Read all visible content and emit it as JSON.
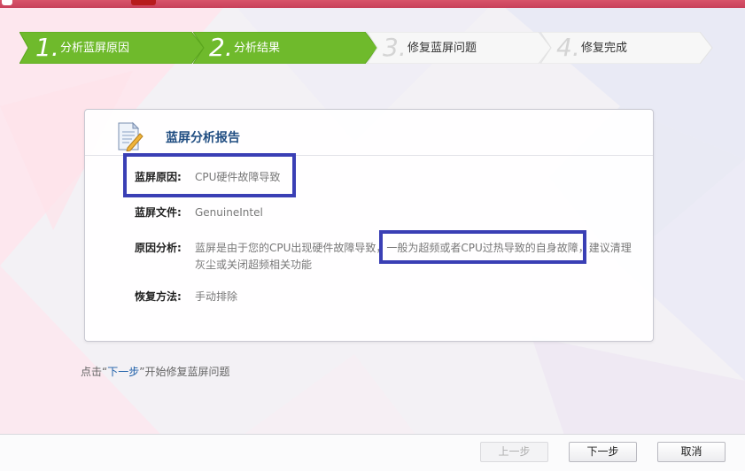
{
  "window": {
    "accent_color": "#d0475f"
  },
  "steps": [
    {
      "number": "1.",
      "label": "分析蓝屏原因",
      "state": "done"
    },
    {
      "number": "2.",
      "label": "分析结果",
      "state": "done"
    },
    {
      "number": "3.",
      "label": "修复蓝屏问题",
      "state": "todo"
    },
    {
      "number": "4.",
      "label": "修复完成",
      "state": "todo"
    }
  ],
  "colors": {
    "step_done": "#6fba2c",
    "step_todo": "#f7f7f7",
    "highlight_box": "#3a3fb5",
    "title_blue": "#214e82"
  },
  "report": {
    "icon": "document-pencil-icon",
    "title": "蓝屏分析报告",
    "cause_label": "蓝屏原因:",
    "cause_value": "CPU硬件故障导致",
    "file_label": "蓝屏文件:",
    "file_value": "GenuineIntel",
    "analysis_label": "原因分析:",
    "analysis_line1": "蓝屏是由于您的CPU出现硬件故障导致，一般为超频或者CPU过热导致的自身故障，建议清理",
    "analysis_line2": "灰尘或关闭超频相关功能",
    "fix_label": "恢复方法:",
    "fix_value": "手动排除"
  },
  "hint": {
    "prefix": "点击“",
    "keyword": "下一步",
    "suffix": "”开始修复蓝屏问题"
  },
  "buttons": {
    "prev": "上一步",
    "next": "下一步",
    "cancel": "取消"
  }
}
